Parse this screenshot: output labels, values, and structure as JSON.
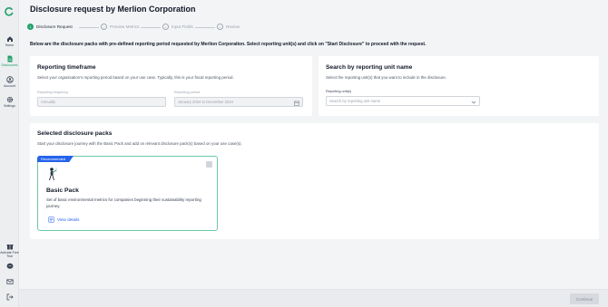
{
  "sidebar": {
    "items": [
      {
        "label": "Home"
      },
      {
        "label": "Disclosures"
      },
      {
        "label": "Account"
      },
      {
        "label": "Settings"
      },
      {
        "label": "Activate Free Trial"
      }
    ]
  },
  "header": {
    "title": "Disclosure request by Merlion Corporation"
  },
  "stepper": {
    "steps": [
      {
        "num": "1",
        "label": "Disclosure Request"
      },
      {
        "num": "2",
        "label": "Preview Metrics"
      },
      {
        "num": "3",
        "label": "Input Fields"
      },
      {
        "num": "4",
        "label": "Review"
      }
    ]
  },
  "instruction": "Below are the disclosure packs with pre-defined reporting period requested by Merlion Corporation. Select reporting unit(s) and click on \"Start Disclosure\" to proceed with the request.",
  "timeframe": {
    "title": "Reporting timeframe",
    "subtitle": "Select your organisation's reporting period based on your use case. Typically, this is your fiscal reporting period.",
    "frequency_label": "Reporting frequency",
    "frequency_value": "Annually",
    "period_label": "Reporting period",
    "period_value": "January 2024 to December 2024"
  },
  "reporting_unit": {
    "title": "Search by reporting unit name",
    "subtitle": "Select the reporting unit(s) that you want to include in the disclosure.",
    "field_label": "Reporting unit(s)",
    "placeholder": "Search by reporting unit name"
  },
  "packs": {
    "title": "Selected disclosure packs",
    "subtitle": "Start your disclosure journey with the Basic Pack and add on relevant disclosure pack(s) based on your use case(s).",
    "card": {
      "badge": "Recommended",
      "name": "Basic Pack",
      "description": "Set of basic environmental metrics for companies beginning their sustainability reporting journey.",
      "link": "View details"
    }
  },
  "footer": {
    "continue_label": "Continue"
  },
  "colors": {
    "accent": "#22a06b",
    "link": "#2563eb",
    "badge": "#2563eb"
  },
  "icons": [
    "logo-icon",
    "home-icon",
    "disclosure-icon",
    "account-icon",
    "gear-icon",
    "gift-icon",
    "chat-icon",
    "mail-icon",
    "logout-icon",
    "calendar-icon",
    "chevron-down-icon",
    "checkbox-icon",
    "document-icon"
  ]
}
